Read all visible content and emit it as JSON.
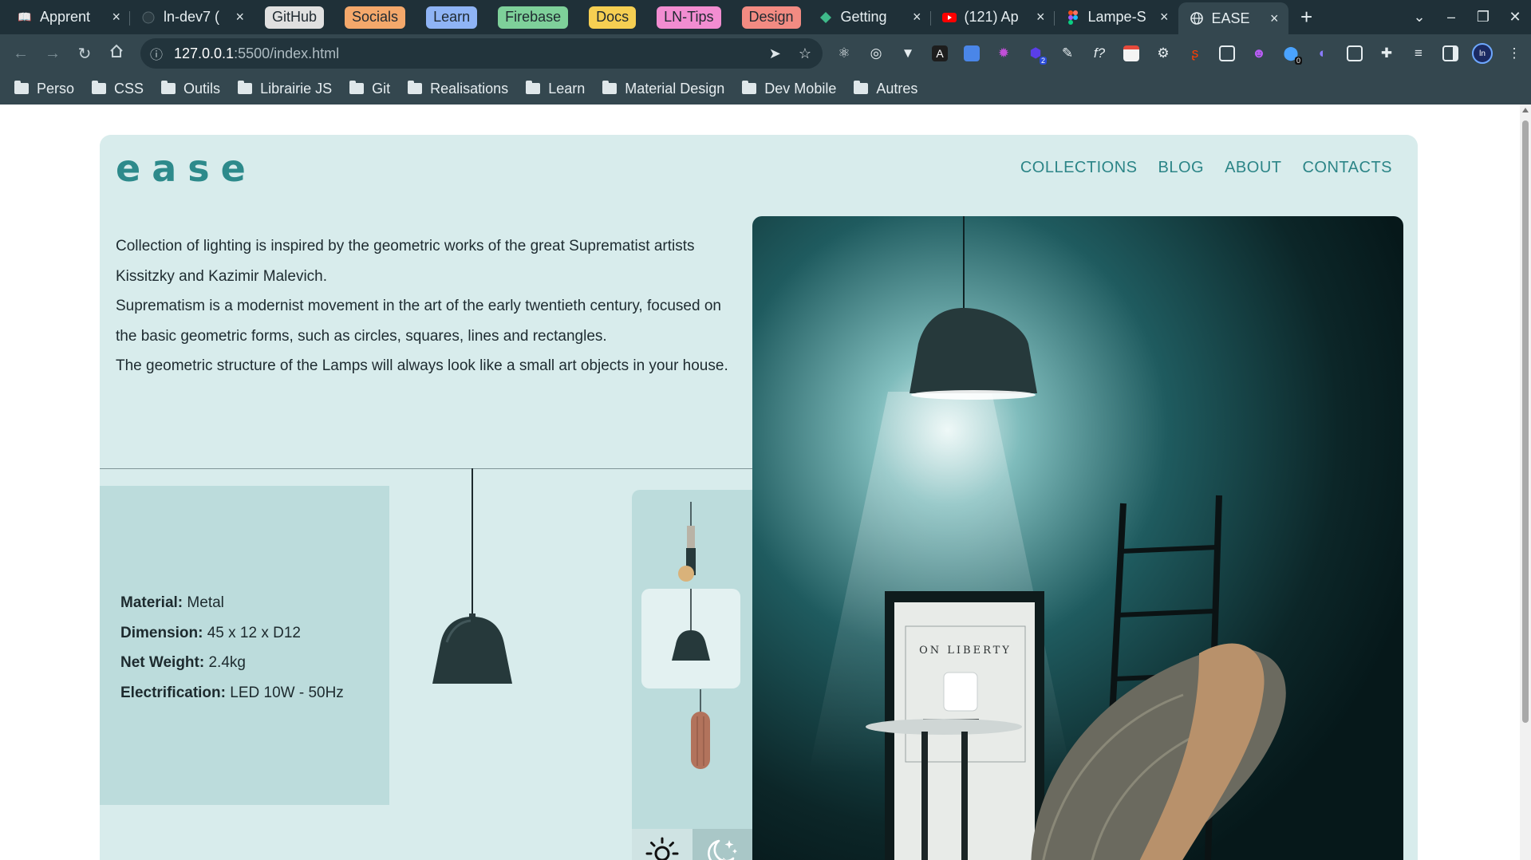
{
  "browser": {
    "tabs": [
      {
        "title": "Apprent",
        "icon": "book-icon"
      },
      {
        "title": "ln-dev7 (",
        "icon": "github-icon"
      },
      {
        "title": "Getting",
        "icon": "vuetify-icon"
      },
      {
        "title": "(121) Ap",
        "icon": "youtube-icon"
      },
      {
        "title": "Lampe-S",
        "icon": "figma-icon"
      },
      {
        "title": "EASE",
        "icon": "globe-icon"
      }
    ],
    "tab_groups": [
      {
        "label": "GitHub",
        "color": "#e0e0e0"
      },
      {
        "label": "Socials",
        "color": "#f4a86b"
      },
      {
        "label": "Learn",
        "color": "#8fb4f5"
      },
      {
        "label": "Firebase",
        "color": "#7ed09a"
      },
      {
        "label": "Docs",
        "color": "#f6cf52"
      },
      {
        "label": "LN-Tips",
        "color": "#f28dd1"
      },
      {
        "label": "Design",
        "color": "#f28b82"
      }
    ],
    "url_host": "127.0.0.1",
    "url_path": ":5500/index.html",
    "bookmarks": [
      "Perso",
      "CSS",
      "Outils",
      "Librairie JS",
      "Git",
      "Realisations",
      "Learn",
      "Material Design",
      "Dev Mobile",
      "Autres"
    ],
    "extension_badges": {
      "two": "2",
      "zero": "0"
    },
    "function_ext_label": "f?"
  },
  "page": {
    "logo": "ease",
    "nav": [
      "COLLECTIONS",
      "BLOG",
      "ABOUT",
      "CONTACTS"
    ],
    "description": [
      "Collection of lighting is inspired by the geometric works of the great Suprematist artists Kissitzky and Kazimir Malevich.",
      "Suprematism is a modernist movement in the art of the early twentieth century, focused on the basic geometric forms, such as circles, squares, lines and rectangles.",
      "The geometric structure of the Lamps will always look like a small art objects in your house."
    ],
    "specs": [
      {
        "label": "Material:",
        "value": "Metal"
      },
      {
        "label": "Dimension:",
        "value": "45 x 12 x D12"
      },
      {
        "label": "Net Weight:",
        "value": "2.4kg"
      },
      {
        "label": "Electrification:",
        "value": "LED 10W - 50Hz"
      }
    ],
    "thumbnails": [
      "cylinder-lamp-thumbnail",
      "dome-lamp-thumbnail",
      "copper-lamp-thumbnail"
    ],
    "selected_thumbnail": 1,
    "poster_text": "ON LIBERTY",
    "colors": {
      "accent": "#2d8a8b",
      "card_bg": "#d8ecec",
      "panel_bg": "#bcdcdc"
    }
  }
}
